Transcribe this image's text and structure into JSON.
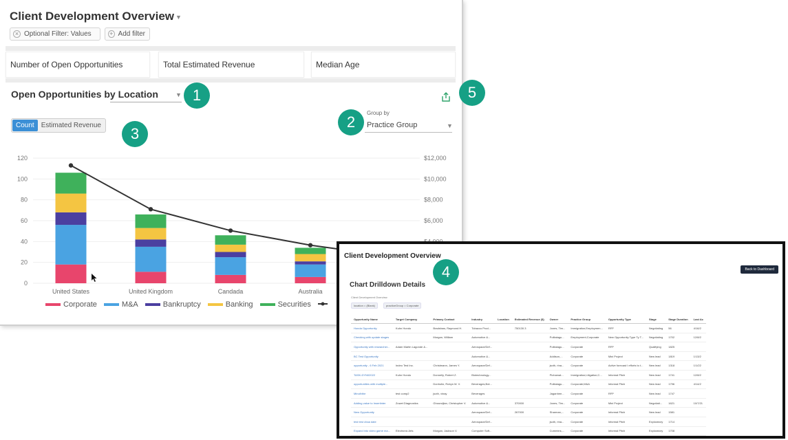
{
  "dashboard": {
    "title": "Client Development Overview",
    "filters": [
      {
        "label": "Optional Filter: Values",
        "icon": "filter-icon"
      },
      {
        "label": "Add filter",
        "icon": "plus-icon"
      }
    ],
    "kpis": [
      "Number of Open Opportunities",
      "Total Estimated Revenue",
      "Median Age"
    ],
    "section": {
      "title_prefix": "Open Opportunities by",
      "dimension": "Location"
    },
    "group_by": {
      "label": "Group by",
      "value": "Practice Group"
    },
    "toggle": {
      "options": [
        "Count",
        "Estimated Revenue"
      ],
      "selected": "Count"
    }
  },
  "callouts": [
    "1",
    "2",
    "3",
    "4",
    "5"
  ],
  "chart_data": {
    "type": "bar",
    "stacked": true,
    "categories": [
      "United States",
      "United Kingdom",
      "Candada",
      "Australia"
    ],
    "series": [
      {
        "name": "Corporate",
        "color": "#e8456c",
        "values": [
          18,
          11,
          8,
          6
        ]
      },
      {
        "name": "M&A",
        "color": "#4aa3e2",
        "values": [
          38,
          24,
          17,
          12
        ]
      },
      {
        "name": "Bankruptcy",
        "color": "#4b3fa0",
        "values": [
          12,
          7,
          5,
          3
        ]
      },
      {
        "name": "Banking",
        "color": "#f4c542",
        "values": [
          18,
          11,
          7,
          7
        ]
      },
      {
        "name": "Securities",
        "color": "#3fb15b",
        "values": [
          20,
          13,
          9,
          6
        ]
      }
    ],
    "line": {
      "name": "Estimated Revenue",
      "values": [
        11300,
        7100,
        5050,
        3650
      ]
    },
    "y_left": {
      "min": 0,
      "max": 120,
      "ticks": [
        "0",
        "20",
        "40",
        "60",
        "80",
        "100",
        "120"
      ]
    },
    "y_right": {
      "min": 0,
      "max": 12000,
      "ticks": [
        "$4,000",
        "$6,000",
        "$8,000",
        "$10,000",
        "$12,000"
      ]
    }
  },
  "drilldown": {
    "title": "Client Development Overview",
    "back_button": "Back to Dashboard",
    "heading": "Chart Drilldown Details",
    "crumb": "Client Development Overview",
    "pills": [
      "location = (Blank)",
      "practiceGroup = Corporate"
    ],
    "columns": [
      "Opportunity Name",
      "Target Company",
      "Primary Contact",
      "Industry",
      "Location",
      "Estimated Revenue ($)",
      "Owner",
      "Practice Group",
      "Opportunity Type",
      "Stage",
      "Stage Duration",
      "Last Ac"
    ],
    "rows": [
      [
        "Honda Opportunity",
        "Kuhn Hondo",
        "Bradshaw, Raymond H.",
        "Tobacco Prod...",
        "",
        "750130.3",
        "Jones, Tim...",
        "Immigration;Employmen...",
        "RFP",
        "Negotiating",
        "56",
        "4/16/2"
      ],
      [
        "Checking with update stages",
        "",
        "Morgan, William",
        "Automotive &...",
        "",
        "",
        "Politalagu...",
        "Employment;Corporate",
        "New Opportunity Type Ty T...",
        "Negotiating",
        "1702",
        "12/8/2"
      ],
      [
        "Opportunity with researcher...",
        "Adam Martin Lagonde &...",
        "",
        "Aerospace/Def...",
        "",
        "",
        "Politalagu...",
        "Corporate",
        "RFP",
        "Qualifying",
        "1825",
        ""
      ],
      [
        "BC Test Opportunity",
        "",
        "",
        "Automotive &...",
        "",
        "",
        "Addison,...",
        "Corporate",
        "Mini Project",
        "New lead",
        "1819",
        "1/13/2"
      ],
      [
        "opportunity - 6 Feb 2021",
        "Indeo Test Inc.",
        "Christmann, James Y.",
        "Aerospace/Def...",
        "",
        "",
        "jsoth, rina...",
        "Corporate",
        "Active forecast I efforts to t...",
        "New lead",
        "1318",
        "1/1/22"
      ],
      [
        "TASK-DYN02022",
        "Kuhn Hondo",
        "Donnelly, Robert Z.",
        "Biotechnology...",
        "",
        "",
        "Pichamat...",
        "Immigration;Litigation;C...",
        "Informal Pitch",
        "New lead",
        "1741",
        "12/8/2"
      ],
      [
        "opportunities with multiple...",
        "",
        "Donholtz, Robyn M. V.",
        "Beverages;Bot...",
        "",
        "",
        "Politalagu...",
        "Corporate;M&A",
        "Informal Pitch",
        "New lead",
        "1796",
        "4/14/2"
      ],
      [
        "Minolhthe",
        "test comp2",
        "jsoth, vinay",
        "Beverages",
        "",
        "",
        "Jaganhee...",
        "Corporate",
        "RFP",
        "New lead",
        "1747",
        ""
      ],
      [
        "Adding value to Insertinter",
        "Zuwet Diagnostics",
        "Ghoundjian, Christopher V.",
        "Automotive &...",
        "",
        "370000",
        "Jones, Tim...",
        "Corporate",
        "Mini Project",
        "Negotiati...",
        "1621",
        "10/7/21"
      ],
      [
        "New Opportunity",
        "",
        "",
        "Aerospace/Def...",
        "",
        "267000",
        "Sharman,...",
        "Corporate",
        "Informal Pitch",
        "New lead",
        "1581",
        ""
      ],
      [
        "test test chaa date",
        "",
        "",
        "Aerospace/Def...",
        "",
        "",
        "jsoth, rina...",
        "Corporate",
        "Informal Pitch",
        "Exploratory",
        "1714",
        ""
      ],
      [
        "Expand into video game ma...",
        "Electronic Arts",
        "Morgan, Jackson V.",
        "Computer Soft...",
        "",
        "",
        "Cummins,...",
        "Corporate",
        "Informal Pitch",
        "Exploratory",
        "1708",
        ""
      ]
    ]
  }
}
